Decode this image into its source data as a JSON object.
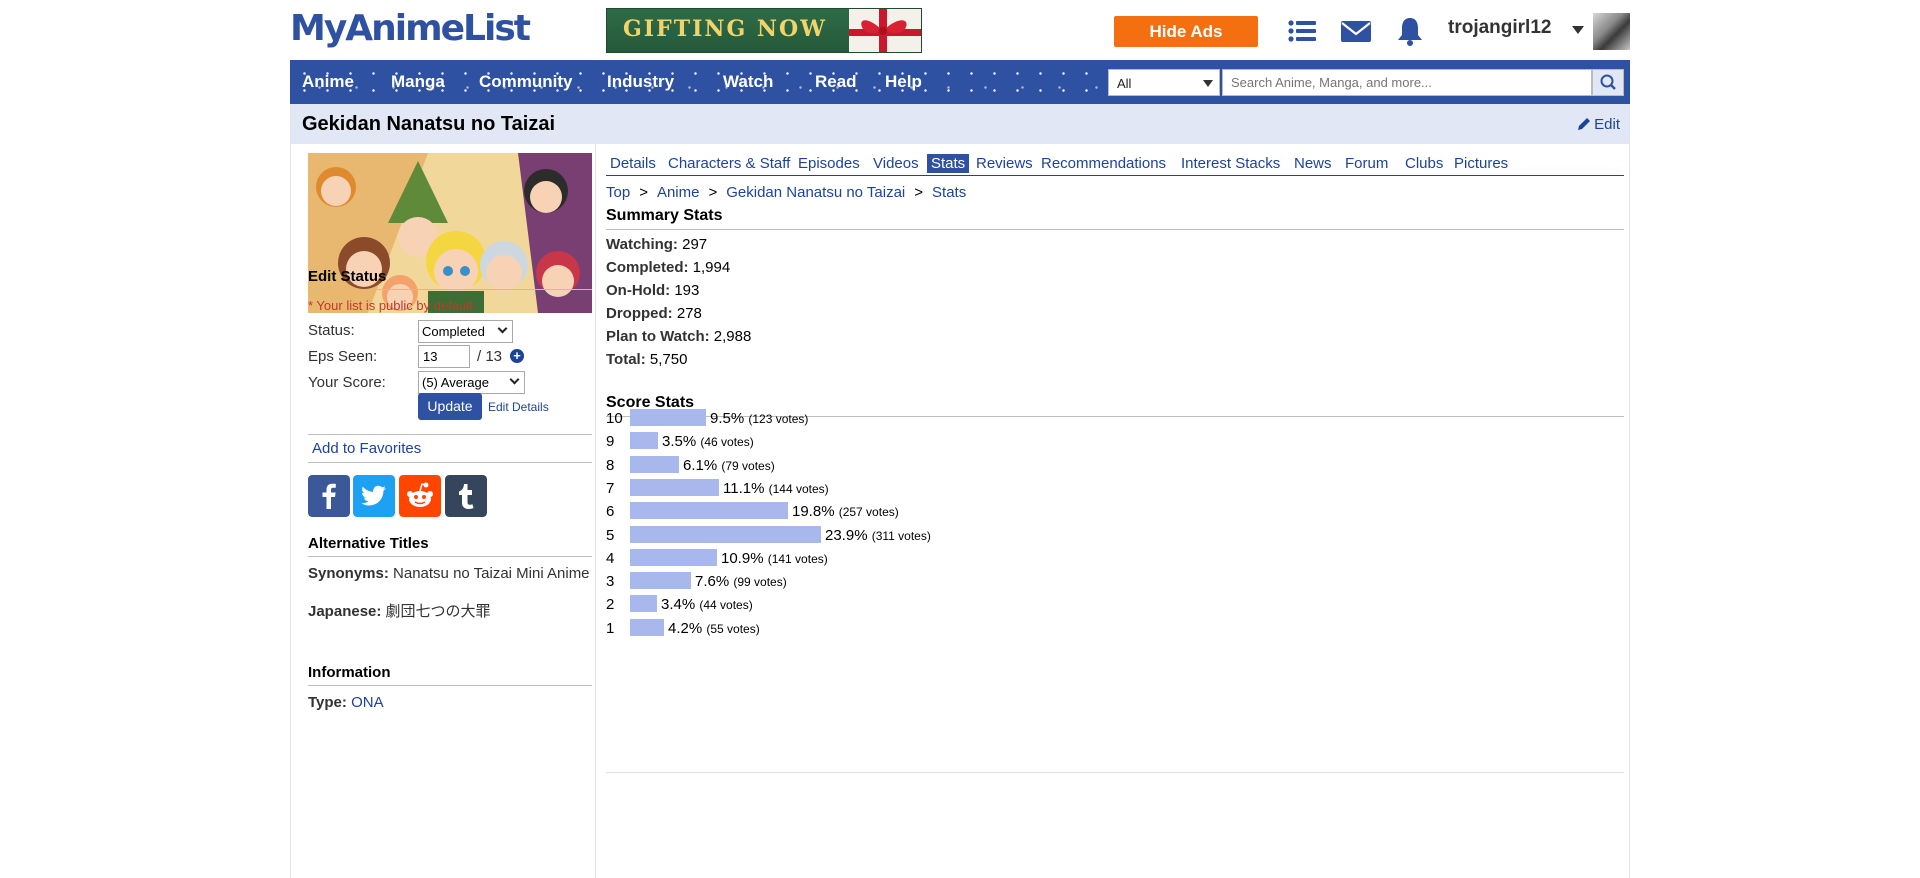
{
  "header": {
    "logo": "MyAnimeList",
    "banner_text": "GIFTING NOW",
    "hide_ads_label": "Hide Ads",
    "username": "trojangirl12",
    "icons": [
      "list-icon",
      "mail-icon",
      "bell-icon"
    ]
  },
  "nav": {
    "items": [
      "Anime",
      "Manga",
      "Community",
      "Industry",
      "Watch",
      "Read",
      "Help"
    ],
    "category": "All",
    "search_placeholder": "Search Anime, Manga, and more..."
  },
  "title": {
    "text": "Gekidan Nanatsu no Taizai",
    "edit_label": "Edit"
  },
  "sidebar": {
    "edit_status_heading": "Edit Status",
    "public_note": "* Your list is public by default.",
    "status_label": "Status:",
    "status_value": "Completed",
    "eps_label": "Eps Seen:",
    "eps_value": "13",
    "eps_total": "/ 13",
    "score_label": "Your Score:",
    "score_value": "(5) Average",
    "update_label": "Update",
    "edit_details_label": "Edit Details",
    "favorites_label": "Add to Favorites",
    "social": [
      "facebook-icon",
      "twitter-icon",
      "reddit-icon",
      "tumblr-icon"
    ],
    "alt_titles_heading": "Alternative Titles",
    "synonyms_label": "Synonyms:",
    "synonyms_value": "Nanatsu no Taizai Mini Anime",
    "japanese_label": "Japanese:",
    "japanese_value": "劇団七つの大罪",
    "information_heading": "Information",
    "type_label": "Type:",
    "type_value": "ONA"
  },
  "tabs": [
    "Details",
    "Characters & Staff",
    "Episodes",
    "Videos",
    "Stats",
    "Reviews",
    "Recommendations",
    "Interest Stacks",
    "News",
    "Forum",
    "Clubs",
    "Pictures"
  ],
  "active_tab": "Stats",
  "breadcrumb": [
    "Top",
    "Anime",
    "Gekidan Nanatsu no Taizai",
    "Stats"
  ],
  "summary": {
    "heading": "Summary Stats",
    "items": [
      {
        "label": "Watching:",
        "value": "297"
      },
      {
        "label": "Completed:",
        "value": "1,994"
      },
      {
        "label": "On-Hold:",
        "value": "193"
      },
      {
        "label": "Dropped:",
        "value": "278"
      },
      {
        "label": "Plan to Watch:",
        "value": "2,988"
      },
      {
        "label": "Total:",
        "value": "5,750"
      }
    ]
  },
  "chart_data": {
    "type": "bar",
    "title": "Score Stats",
    "categories": [
      "10",
      "9",
      "8",
      "7",
      "6",
      "5",
      "4",
      "3",
      "2",
      "1"
    ],
    "values": [
      9.5,
      3.5,
      6.1,
      11.1,
      19.8,
      23.9,
      10.9,
      7.6,
      3.4,
      4.2
    ],
    "labels": [
      "9.5%",
      "3.5%",
      "6.1%",
      "11.1%",
      "19.8%",
      "23.9%",
      "10.9%",
      "7.6%",
      "3.4%",
      "4.2%"
    ],
    "votes": [
      "(123 votes)",
      "(46 votes)",
      "(79 votes)",
      "(144 votes)",
      "(257 votes)",
      "(311 votes)",
      "(141 votes)",
      "(99 votes)",
      "(44 votes)",
      "(55 votes)"
    ],
    "bar_color": "#a8b8ec"
  },
  "colors": {
    "brand": "#2e51a2",
    "link": "#1c439b",
    "hide_ads": "#f36f10",
    "title_bar": "#e1e7f5"
  }
}
